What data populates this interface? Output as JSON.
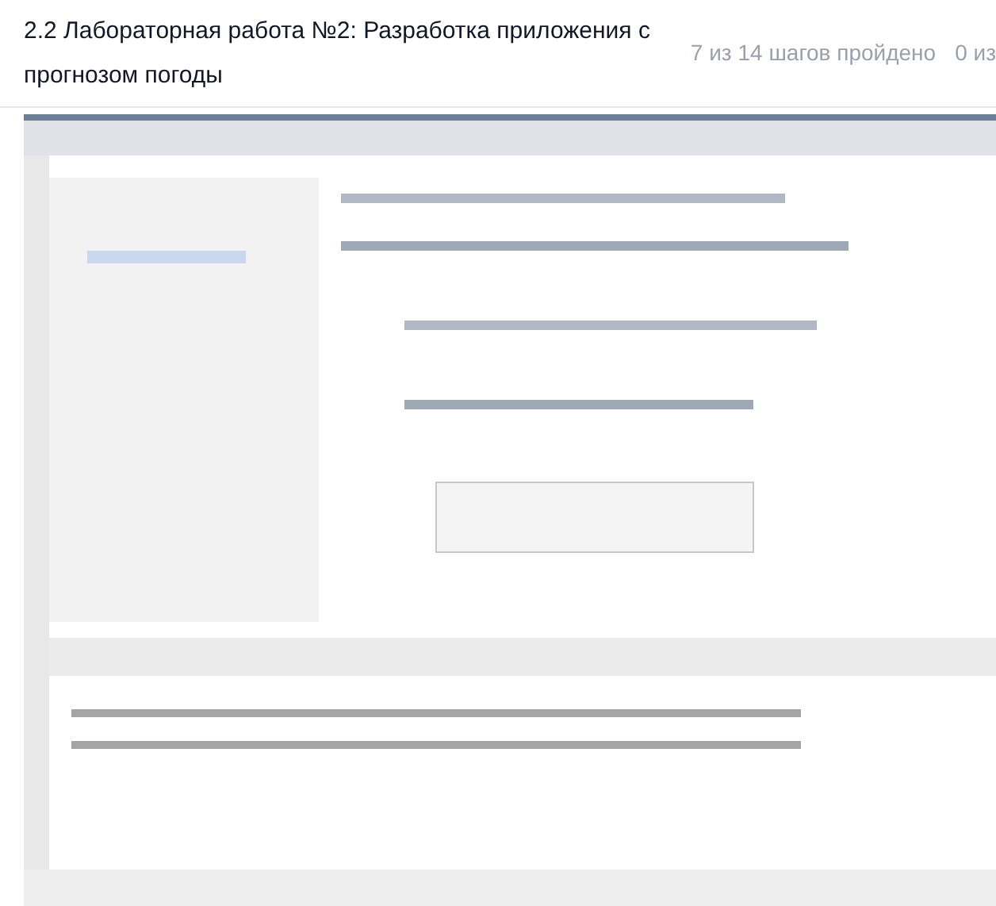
{
  "lesson": {
    "title": "2.2 Лабораторная работа №2: Разработка приложения с прогнозом погоды"
  },
  "progress": {
    "steps": "7 из 14 шагов пройдено",
    "column_2": "0 из"
  }
}
